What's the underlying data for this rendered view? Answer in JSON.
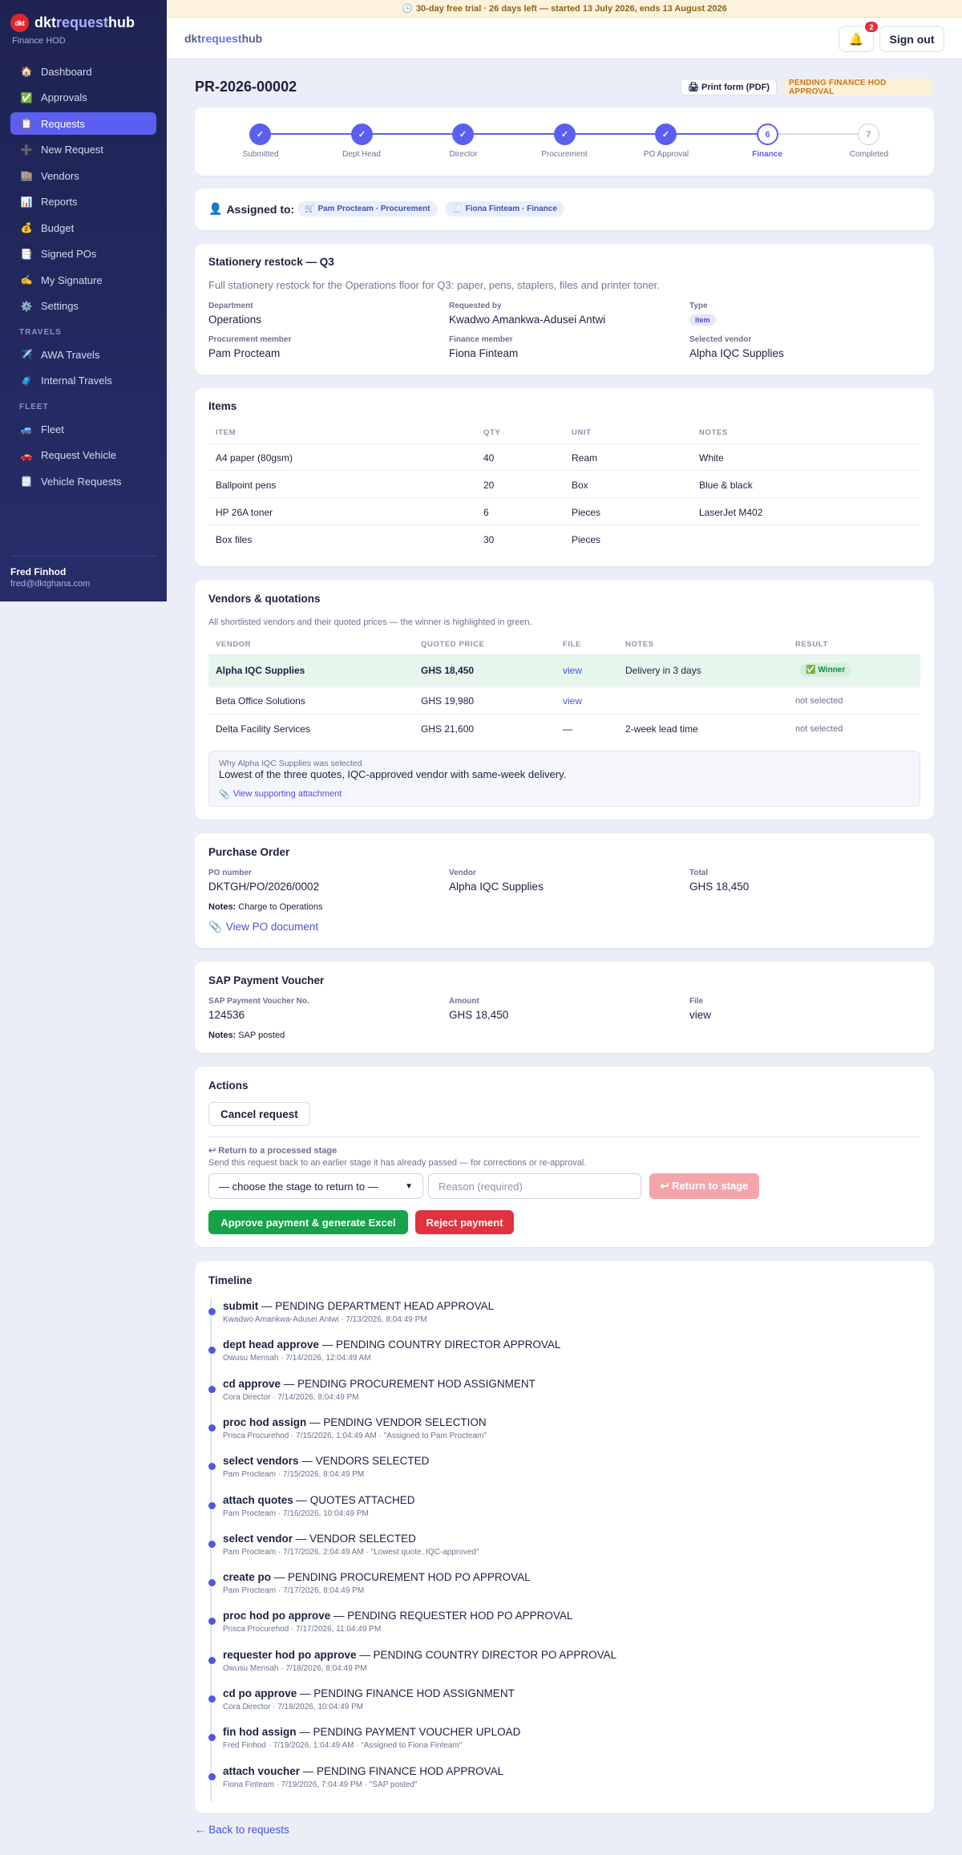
{
  "sidebar": {
    "logo_text": "dkt",
    "brand": {
      "pre": "dkt",
      "mid": "request",
      "post": "hub"
    },
    "subtitle": "Finance HOD",
    "items": [
      {
        "label": "Dashboard",
        "icon": "🏠"
      },
      {
        "label": "Approvals",
        "icon": "✅"
      },
      {
        "label": "Requests",
        "icon": "📋",
        "active": true
      },
      {
        "label": "New Request",
        "icon": "➕"
      },
      {
        "label": "Vendors",
        "icon": "🏬"
      },
      {
        "label": "Reports",
        "icon": "📊"
      },
      {
        "label": "Budget",
        "icon": "💰"
      },
      {
        "label": "Signed POs",
        "icon": "📑"
      },
      {
        "label": "My Signature",
        "icon": "✍️"
      },
      {
        "label": "Settings",
        "icon": "⚙️"
      }
    ],
    "travels_heading": "TRAVELS",
    "travels": [
      {
        "label": "AWA Travels",
        "icon": "✈️"
      },
      {
        "label": "Internal Travels",
        "icon": "🧳"
      }
    ],
    "fleet_heading": "FLEET",
    "fleet": [
      {
        "label": "Fleet",
        "icon": "🚙"
      },
      {
        "label": "Request Vehicle",
        "icon": "🚗"
      },
      {
        "label": "Vehicle Requests",
        "icon": "🗒️"
      }
    ],
    "user": {
      "name": "Fred Finhod",
      "email": "fred@dktghana.com"
    }
  },
  "trial_banner": {
    "icon": "🕒",
    "text": "30-day free trial · 26 days left — started 13 July 2026, ends 13 August 2026"
  },
  "header": {
    "brand": {
      "pre": "dkt",
      "mid": "request",
      "post": "hub"
    },
    "bell_icon": "🔔",
    "notification_count": "2",
    "sign_out": "Sign out"
  },
  "request": {
    "id": "PR-2026-00002",
    "print_label": "🖨 Print form (PDF)",
    "status": "PENDING FINANCE HOD APPROVAL"
  },
  "stepper": {
    "steps": [
      {
        "label": "Submitted",
        "mark": "✓",
        "state": "done"
      },
      {
        "label": "Dept Head",
        "mark": "✓",
        "state": "done"
      },
      {
        "label": "Director",
        "mark": "✓",
        "state": "done"
      },
      {
        "label": "Procurement",
        "mark": "✓",
        "state": "done"
      },
      {
        "label": "PO Approval",
        "mark": "✓",
        "state": "done"
      },
      {
        "label": "Finance",
        "mark": "6",
        "state": "current"
      },
      {
        "label": "Completed",
        "mark": "7",
        "state": "todo"
      }
    ]
  },
  "assigned": {
    "icon": "👤",
    "label": "Assigned to:",
    "chips": [
      {
        "icon": "🛒",
        "text": "Pam Procteam · Procurement"
      },
      {
        "icon": "🧾",
        "text": "Fiona Finteam · Finance"
      }
    ]
  },
  "details": {
    "title": "Stationery restock — Q3",
    "description": "Full stationery restock for the Operations floor for Q3: paper, pens, staplers, files and printer toner.",
    "department_label": "Department",
    "department": "Operations",
    "requested_by_label": "Requested by",
    "requested_by": "Kwadwo Amankwa-Adusei Antwi",
    "type_label": "Type",
    "type": "item",
    "procurement_label": "Procurement member",
    "procurement": "Pam Procteam",
    "finance_label": "Finance member",
    "finance": "Fiona Finteam",
    "vendor_label": "Selected vendor",
    "vendor": "Alpha IQC Supplies"
  },
  "items": {
    "title": "Items",
    "columns": [
      "ITEM",
      "QTY",
      "UNIT",
      "NOTES"
    ],
    "rows": [
      [
        "A4 paper (80gsm)",
        "40",
        "Ream",
        "White"
      ],
      [
        "Ballpoint pens",
        "20",
        "Box",
        "Blue & black"
      ],
      [
        "HP 26A toner",
        "6",
        "Pieces",
        "LaserJet M402"
      ],
      [
        "Box files",
        "30",
        "Pieces",
        ""
      ]
    ]
  },
  "vendors": {
    "title": "Vendors & quotations",
    "subtitle": "All shortlisted vendors and their quoted prices — the winner is highlighted in green.",
    "columns": [
      "VENDOR",
      "QUOTED PRICE",
      "FILE",
      "NOTES",
      "RESULT"
    ],
    "rows": [
      {
        "vendor": "Alpha IQC Supplies",
        "price": "GHS 18,450",
        "file": "view",
        "notes": "Delivery in 3 days",
        "result": "Winner",
        "result_icon": "✅",
        "winner": true
      },
      {
        "vendor": "Beta Office Solutions",
        "price": "GHS 19,980",
        "file": "view",
        "notes": "",
        "result": "not selected"
      },
      {
        "vendor": "Delta Facility Services",
        "price": "GHS 21,600",
        "file": "—",
        "notes": "2-week lead time",
        "result": "not selected"
      }
    ],
    "why_label": "Why Alpha IQC Supplies was selected",
    "why_text": "Lowest of the three quotes, IQC-approved vendor with same-week delivery.",
    "attachment_icon": "📎",
    "attachment_label": "View supporting attachment"
  },
  "purchase_order": {
    "title": "Purchase Order",
    "po_label": "PO number",
    "po": "DKTGH/PO/2026/0002",
    "vendor_label": "Vendor",
    "vendor": "Alpha IQC Supplies",
    "total_label": "Total",
    "total": "GHS 18,450",
    "notes_label": "Notes:",
    "notes": "Charge to Operations",
    "doc_icon": "📎",
    "doc_label": "View PO document"
  },
  "sap": {
    "title": "SAP Payment Voucher",
    "no_label": "SAP Payment Voucher No.",
    "no": "124536",
    "amount_label": "Amount",
    "amount": "GHS 18,450",
    "file_label": "File",
    "file": "view",
    "notes_label": "Notes:",
    "notes": "SAP posted"
  },
  "actions": {
    "title": "Actions",
    "cancel": "Cancel request",
    "return_title": "↩ Return to a processed stage",
    "return_desc": "Send this request back to an earlier stage it has already passed — for corrections or re-approval.",
    "select_placeholder": "— choose the stage to return to —",
    "reason_placeholder": "Reason (required)",
    "return_button": "↩ Return to stage",
    "approve": "Approve payment & generate Excel",
    "reject": "Reject payment"
  },
  "timeline": {
    "title": "Timeline",
    "events": [
      {
        "action": "submit",
        "status": "PENDING DEPARTMENT HEAD APPROVAL",
        "meta": "Kwadwo Amankwa-Adusei Antwi · 7/13/2026, 8:04:49 PM"
      },
      {
        "action": "dept head approve",
        "status": "PENDING COUNTRY DIRECTOR APPROVAL",
        "meta": "Owusu Mensah · 7/14/2026, 12:04:49 AM"
      },
      {
        "action": "cd approve",
        "status": "PENDING PROCUREMENT HOD ASSIGNMENT",
        "meta": "Cora Director · 7/14/2026, 8:04:49 PM"
      },
      {
        "action": "proc hod assign",
        "status": "PENDING VENDOR SELECTION",
        "meta": "Prisca Procurehod · 7/15/2026, 1:04:49 AM · \"Assigned to Pam Procteam\""
      },
      {
        "action": "select vendors",
        "status": "VENDORS SELECTED",
        "meta": "Pam Procteam · 7/15/2026, 8:04:49 PM"
      },
      {
        "action": "attach quotes",
        "status": "QUOTES ATTACHED",
        "meta": "Pam Procteam · 7/16/2026, 10:04:49 PM"
      },
      {
        "action": "select vendor",
        "status": "VENDOR SELECTED",
        "meta": "Pam Procteam · 7/17/2026, 2:04:49 AM · \"Lowest quote, IQC-approved\""
      },
      {
        "action": "create po",
        "status": "PENDING PROCUREMENT HOD PO APPROVAL",
        "meta": "Pam Procteam · 7/17/2026, 8:04:49 PM"
      },
      {
        "action": "proc hod po approve",
        "status": "PENDING REQUESTER HOD PO APPROVAL",
        "meta": "Prisca Procurehod · 7/17/2026, 11:04:49 PM"
      },
      {
        "action": "requester hod po approve",
        "status": "PENDING COUNTRY DIRECTOR PO APPROVAL",
        "meta": "Owusu Mensah · 7/18/2026, 8:04:49 PM"
      },
      {
        "action": "cd po approve",
        "status": "PENDING FINANCE HOD ASSIGNMENT",
        "meta": "Cora Director · 7/18/2026, 10:04:49 PM"
      },
      {
        "action": "fin hod assign",
        "status": "PENDING PAYMENT VOUCHER UPLOAD",
        "meta": "Fred Finhod · 7/19/2026, 1:04:49 AM · \"Assigned to Fiona Finteam\""
      },
      {
        "action": "attach voucher",
        "status": "PENDING FINANCE HOD APPROVAL",
        "meta": "Fiona Finteam · 7/19/2026, 7:04:49 PM · \"SAP posted\""
      }
    ]
  },
  "back_link": "← Back to requests"
}
